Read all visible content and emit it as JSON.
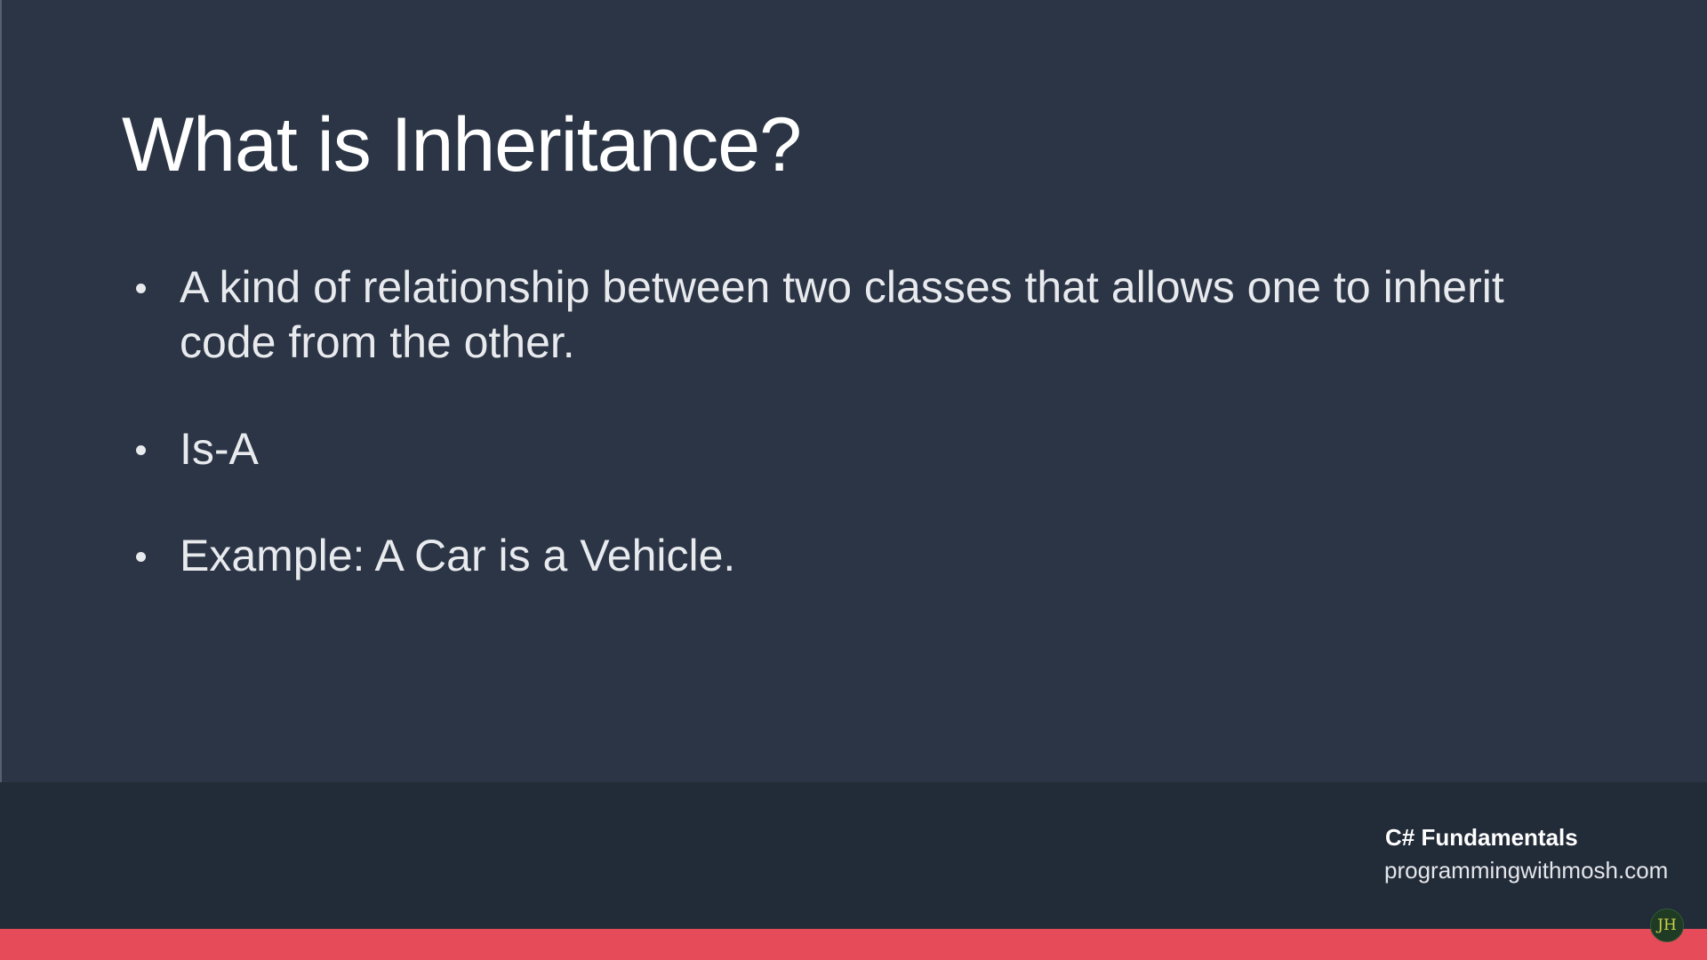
{
  "slide": {
    "title": "What is Inheritance?",
    "bullets": [
      "A kind of relationship between two classes that allows one to inherit code from the other.",
      "Is-A",
      "Example: A Car is a Vehicle."
    ]
  },
  "footer": {
    "course": "C# Fundamentals",
    "site": "programmingwithmosh.com"
  },
  "watermark": {
    "text": "JH"
  },
  "colors": {
    "background": "#2b3545",
    "footer_background": "#222b38",
    "accent_bar": "#e54b59"
  }
}
